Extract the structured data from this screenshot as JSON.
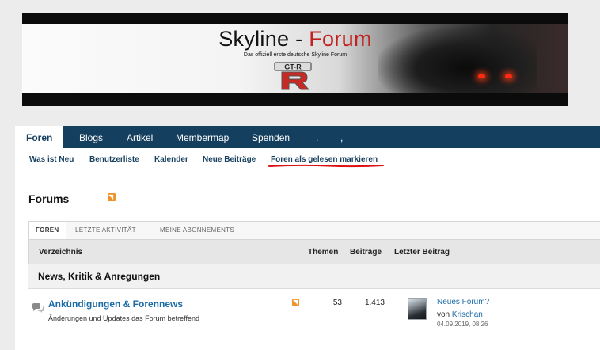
{
  "banner": {
    "title_main": "Skyline -",
    "title_accent": "Forum",
    "subtitle": "Das offiziell erste deutsche Skyline Forum",
    "logo_text": "GT-R",
    "colors": {
      "accent": "#c0231f",
      "nav": "#153f5e"
    }
  },
  "nav": {
    "tabs": [
      {
        "label": "Foren",
        "active": true
      },
      {
        "label": "Blogs"
      },
      {
        "label": "Artikel"
      },
      {
        "label": "Membermap"
      },
      {
        "label": "Spenden"
      },
      {
        "label": "."
      },
      {
        "label": ","
      }
    ]
  },
  "subnav": {
    "links": [
      {
        "label": "Was ist Neu"
      },
      {
        "label": "Benutzerliste"
      },
      {
        "label": "Kalender"
      },
      {
        "label": "Neue Beiträge"
      },
      {
        "label": "Foren als gelesen markieren"
      }
    ]
  },
  "page": {
    "title": "Forums",
    "rss_icon": "rss-icon"
  },
  "sub_tabs": [
    {
      "label": "FOREN",
      "active": true
    },
    {
      "label": "LETZTE AKTIVITÄT"
    },
    {
      "label": "MEINE ABONNEMENTS"
    }
  ],
  "table": {
    "headers": {
      "directory": "Verzeichnis",
      "topics": "Themen",
      "posts": "Beiträge",
      "last_post": "Letzter Beitrag"
    },
    "category": "News, Kritik & Anregungen",
    "forums": [
      {
        "name": "Ankündigungen & Forennews",
        "description": "Änderungen und Updates das Forum betreffend",
        "topics": "53",
        "posts": "1.413",
        "last_title": "Neues Forum?",
        "last_by_prefix": "von",
        "last_user": "Krischan",
        "last_date": "04.09.2019, 08:26"
      }
    ]
  }
}
